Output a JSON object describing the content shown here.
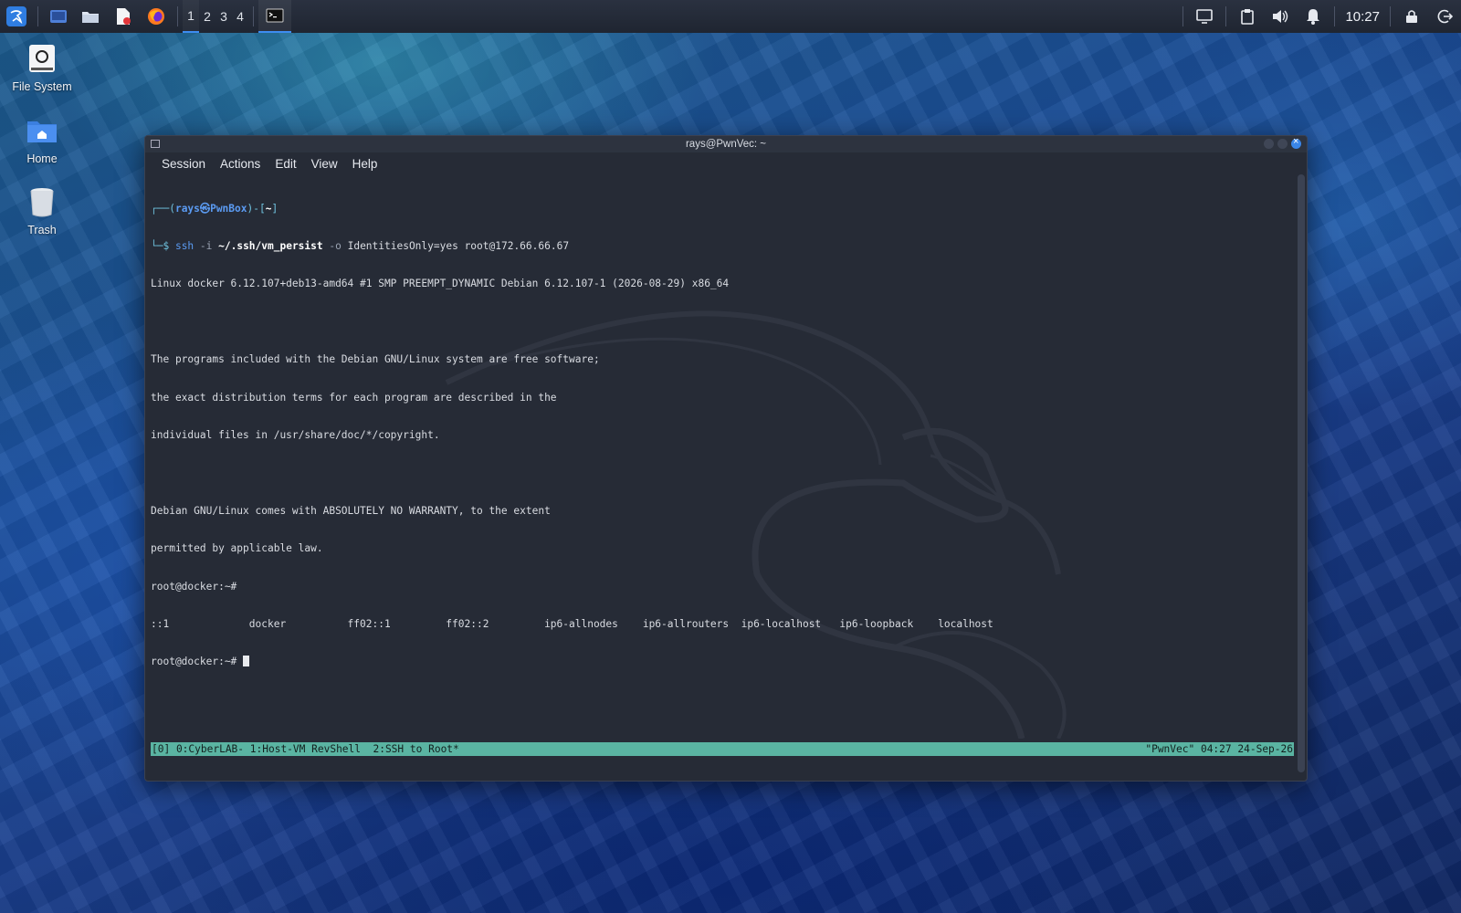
{
  "taskbar": {
    "workspaces": [
      "1",
      "2",
      "3",
      "4"
    ],
    "clock": "10:27",
    "icons": [
      "kali-menu-icon",
      "show-desktop-icon",
      "file-manager-icon",
      "text-editor-icon",
      "firefox-icon",
      "terminal-task-icon",
      "display-icon",
      "clipboard-icon",
      "volume-icon",
      "notifications-icon",
      "lock-icon",
      "logout-icon"
    ]
  },
  "desktop": {
    "icons": [
      {
        "label": "File System"
      },
      {
        "label": "Home"
      },
      {
        "label": "Trash"
      }
    ]
  },
  "window": {
    "title": "rays@PwnVec: ~",
    "menu": [
      "Session",
      "Actions",
      "Edit",
      "View",
      "Help"
    ]
  },
  "terminal": {
    "prompt_open": "┌──(",
    "prompt_user": "rays㉿PwnBox",
    "prompt_mid": ")-[",
    "prompt_dir": "~",
    "prompt_close": "]",
    "cmd_prefix": "└─$ ",
    "cmd_ssh": "ssh",
    "cmd_flag_i": " -i ",
    "cmd_keyfile": "~/.ssh/vm_persist",
    "cmd_flag_o": " -o ",
    "cmd_rest": "IdentitiesOnly=yes root@172.66.66.67",
    "lines": [
      "Linux docker 6.12.107+deb13-amd64 #1 SMP PREEMPT_DYNAMIC Debian 6.12.107-1 (2026-08-29) x86_64",
      "",
      "The programs included with the Debian GNU/Linux system are free software;",
      "the exact distribution terms for each program are described in the",
      "individual files in /usr/share/doc/*/copyright.",
      "",
      "Debian GNU/Linux comes with ABSOLUTELY NO WARRANTY, to the extent",
      "permitted by applicable law.",
      "root@docker:~# ",
      "::1             docker          ff02::1         ff02::2         ip6-allnodes    ip6-allrouters  ip6-localhost   ip6-loopback    localhost"
    ],
    "current_prompt": "root@docker:~# "
  },
  "tmux": {
    "left": "[0] 0:CyberLAB- 1:Host-VM RevShell  2:SSH to Root*",
    "right": "\"PwnVec\" 04:27 24-Sep-26"
  },
  "colors": {
    "accent": "#3d8cf0",
    "tmux_bar": "#5ab4a2",
    "terminal_bg": "#262b36",
    "prompt_blue": "#5b9bf2"
  }
}
